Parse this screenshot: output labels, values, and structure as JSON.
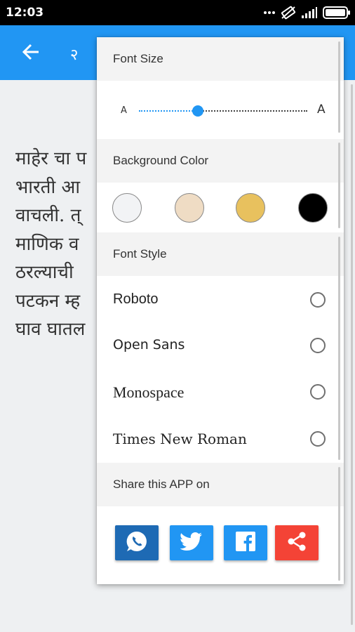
{
  "status_bar": {
    "time": "12:03",
    "icons": [
      "signal-dots-icon",
      "rotation-lock-icon",
      "cellular-signal-icon",
      "battery-icon"
    ]
  },
  "app_bar": {
    "back_icon": "arrow-back-icon",
    "title": "२",
    "color": "#2196f3"
  },
  "content": {
    "lines": [
      "माहेर चा प",
      "भारती आ",
      "वाचली. त्",
      "माणिक व",
      "ठरल्याची",
      "पटकन म्ह",
      "घाव घातल"
    ]
  },
  "settings_panel": {
    "font_size": {
      "header": "Font Size",
      "small_label": "A",
      "large_label": "A",
      "value": 0.35
    },
    "background_color": {
      "header": "Background Color",
      "swatches": [
        {
          "name": "white",
          "color": "#f2f3f5"
        },
        {
          "name": "beige",
          "color": "#efdcc4"
        },
        {
          "name": "gold",
          "color": "#e8c15e"
        },
        {
          "name": "black",
          "color": "#000000"
        }
      ]
    },
    "font_style": {
      "header": "Font Style",
      "options": [
        {
          "label": "Roboto",
          "selected": false
        },
        {
          "label": "Open Sans",
          "selected": false
        },
        {
          "label": "Monospace",
          "selected": false
        },
        {
          "label": "Times New Roman",
          "selected": false
        }
      ]
    },
    "share": {
      "header": "Share this APP on",
      "buttons": [
        {
          "name": "whatsapp",
          "icon": "whatsapp-icon",
          "color": "#1e6ab4"
        },
        {
          "name": "twitter",
          "icon": "twitter-icon",
          "color": "#2196f3"
        },
        {
          "name": "facebook",
          "icon": "facebook-icon",
          "color": "#2196f3"
        },
        {
          "name": "share",
          "icon": "share-icon",
          "color": "#f44336"
        }
      ]
    }
  }
}
